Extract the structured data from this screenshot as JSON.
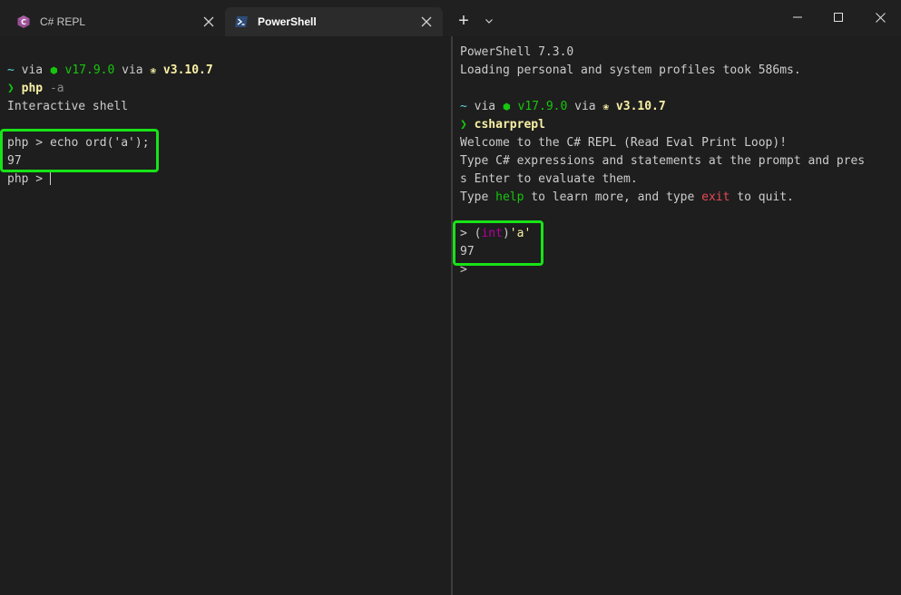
{
  "tabs": [
    {
      "label": "C# REPL",
      "icon": "csharp-icon",
      "active": false
    },
    {
      "label": "PowerShell",
      "icon": "powershell-icon",
      "active": true
    }
  ],
  "titlebar": {
    "new_tab": "+",
    "dropdown_icon": "chevron-down-icon"
  },
  "window_controls": [
    "minimize-icon",
    "maximize-icon",
    "close-icon"
  ],
  "left_pane": {
    "prompt": {
      "tilde": "~",
      "via1": " via ",
      "node_icon": "⬢",
      "node_version": " v17.9.0",
      "via2": " via ",
      "python_icon": "🐍",
      "python_version": " v3.10.7"
    },
    "cmd_arrow": "❯",
    "cmd_name": " php",
    "cmd_arg": " -a",
    "output1": "Interactive shell",
    "php_input": "php > echo ord('a');",
    "php_output": "97",
    "php_prompt": "php > "
  },
  "right_pane": {
    "ps_version": "PowerShell 7.3.0",
    "ps_loading": "Loading personal and system profiles took 586ms.",
    "prompt": {
      "tilde": "~",
      "via1": " via ",
      "node_icon": "⬢",
      "node_version": " v17.9.0",
      "via2": " via ",
      "python_icon": "🐍",
      "python_version": " v3.10.7"
    },
    "cmd_arrow": "❯",
    "cmd_name": " csharprepl",
    "welcome": "Welcome to the C# REPL (Read Eval Print Loop)!",
    "type_line1": "Type C# expressions and statements at the prompt and pres",
    "type_line2": "s Enter to evaluate them.",
    "help_pre": "Type ",
    "help_word": "help",
    "help_mid": " to learn more, and type ",
    "exit_word": "exit",
    "help_post": " to quit.",
    "repl_prompt": "> ",
    "repl_paren_open": "(",
    "repl_keyword": "int",
    "repl_paren_close": ")",
    "repl_literal": "'a'",
    "repl_output": "97",
    "repl_next_prompt": ">"
  },
  "colors": {
    "highlight": "#17e317",
    "green": "#16c60c",
    "yellow": "#f9f1a5",
    "cyan": "#61d6d6"
  }
}
